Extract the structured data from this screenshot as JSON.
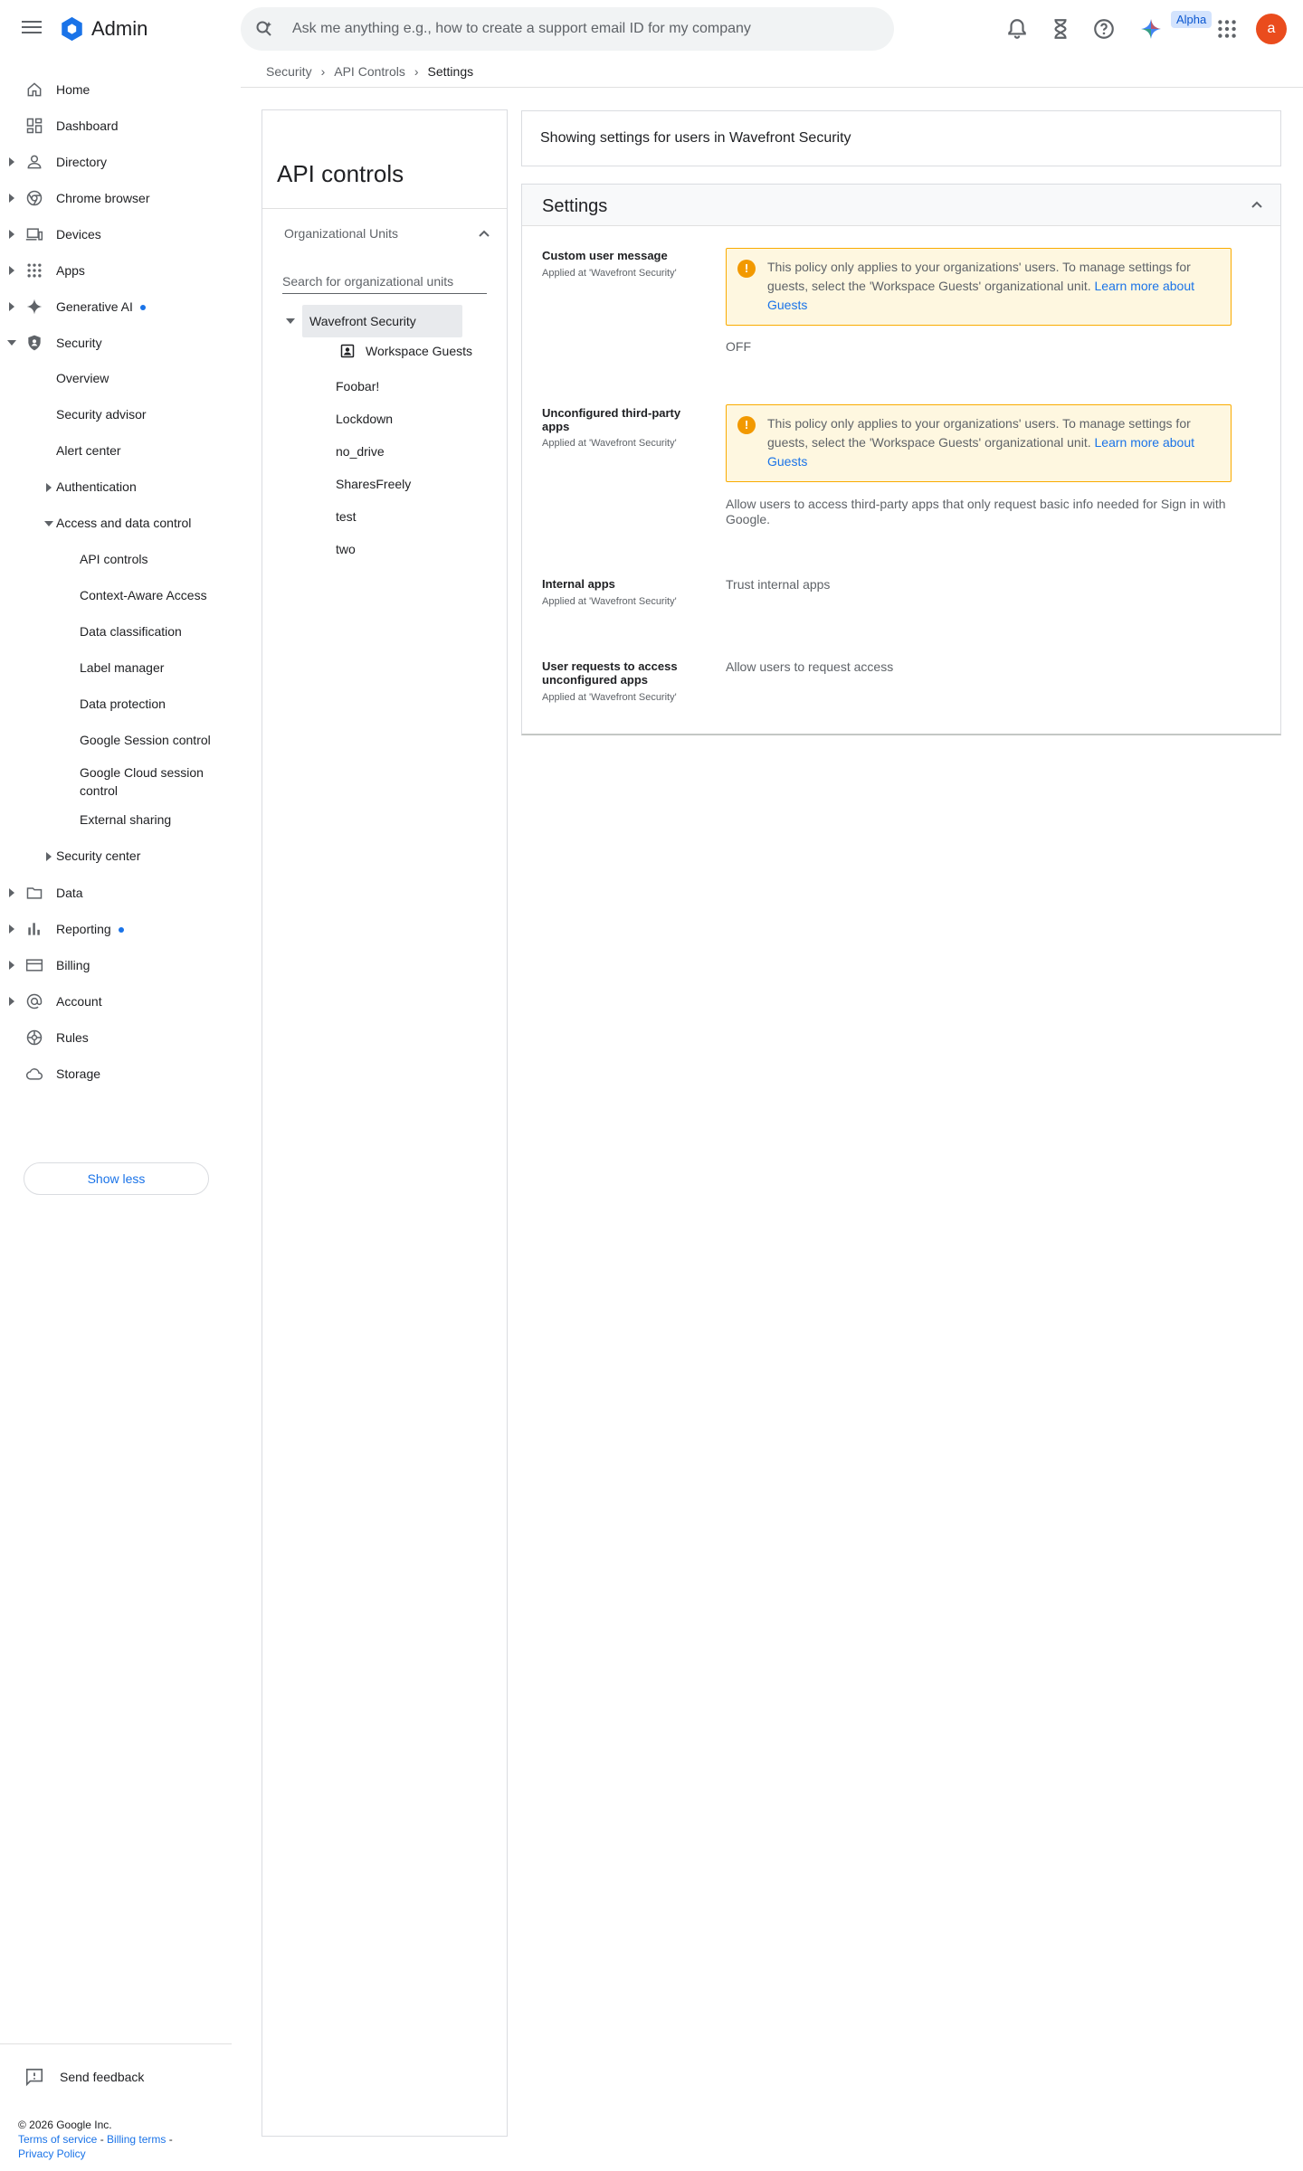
{
  "app": {
    "title": "Admin"
  },
  "search": {
    "placeholder": "Ask me anything e.g., how to create a support email ID for my company"
  },
  "header": {
    "alpha_badge": "Alpha",
    "avatar_letter": "a"
  },
  "breadcrumb": {
    "items": [
      "Security",
      "API Controls",
      "Settings"
    ]
  },
  "sidebar": {
    "items": [
      {
        "label": "Home"
      },
      {
        "label": "Dashboard"
      },
      {
        "label": "Directory"
      },
      {
        "label": "Chrome browser"
      },
      {
        "label": "Devices"
      },
      {
        "label": "Apps"
      },
      {
        "label": "Generative AI"
      },
      {
        "label": "Security"
      },
      {
        "label": "Data"
      },
      {
        "label": "Reporting"
      },
      {
        "label": "Billing"
      },
      {
        "label": "Account"
      },
      {
        "label": "Rules"
      },
      {
        "label": "Storage"
      }
    ],
    "security_sub": [
      "Overview",
      "Security advisor",
      "Alert center",
      "Authentication",
      "Access and data control",
      "Security center"
    ],
    "access_sub": [
      "API controls",
      "Context-Aware Access",
      "Data classification",
      "Label manager",
      "Data protection",
      "Google Session control",
      "Google Cloud session control",
      "External sharing"
    ],
    "show_less": "Show less",
    "send_feedback": "Send feedback"
  },
  "footer": {
    "copyright": "© 2026 Google Inc.",
    "terms": "Terms of service",
    "billing_terms": "Billing terms",
    "privacy": "Privacy Policy",
    "sep": " - "
  },
  "ou": {
    "title": "API controls",
    "heading": "Organizational Units",
    "search_placeholder": "Search for organizational units",
    "root": "Wavefront Security",
    "guests": "Workspace Guests",
    "children": [
      "Foobar!",
      "Lockdown",
      "no_drive",
      "SharesFreely",
      "test",
      "two"
    ]
  },
  "info": {
    "text": "Showing settings for users in Wavefront Security"
  },
  "settings": {
    "title": "Settings",
    "rows": [
      {
        "title": "Custom user message",
        "applied": "Applied at 'Wavefront Security'",
        "value": "OFF"
      },
      {
        "title": "Unconfigured third-party apps",
        "applied": "Applied at 'Wavefront Security'",
        "value": "Allow users to access third-party apps that only request basic info needed for Sign in with Google."
      },
      {
        "title": "Internal apps",
        "applied": "Applied at 'Wavefront Security'",
        "value": "Trust internal apps"
      },
      {
        "title": "User requests to access unconfigured apps",
        "applied": "Applied at 'Wavefront Security'",
        "value": "Allow users to request access"
      }
    ],
    "warning": {
      "text": "This policy only applies to your organizations' users. To manage settings for guests, select the 'Workspace Guests' organizational unit.",
      "link": "Learn more about Guests",
      "icon": "!"
    }
  },
  "colors": {
    "accent": "#1a73e8",
    "warning_bg": "#fef7e0",
    "warning_border": "#f9ab00",
    "avatar": "#ea4c1d"
  }
}
